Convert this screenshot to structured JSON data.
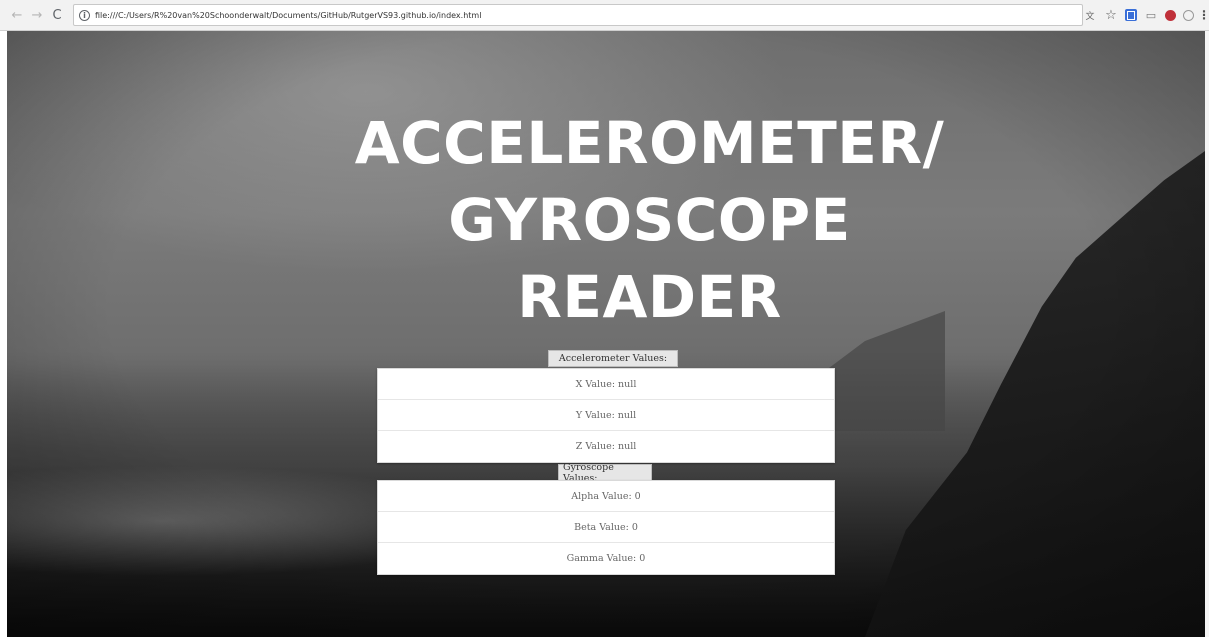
{
  "browser": {
    "url": "file:///C:/Users/R%20van%20Schoonderwalt/Documents/GitHub/RutgerVS93.github.io/index.html",
    "back_icon": "←",
    "forward_icon": "→",
    "reload_icon": "C",
    "info_icon": "i",
    "star_icon": "☆",
    "menu_icon": "⋮"
  },
  "page": {
    "title_lines": [
      "ACCELEROMETER/",
      "GYROSCOPE",
      "READER"
    ],
    "accelerometer": {
      "label": "Accelerometer Values:",
      "rows": [
        "X Value: null",
        "Y Value: null",
        "Z Value: null"
      ]
    },
    "gyroscope": {
      "label": "Gyroscope Values:",
      "rows": [
        "Alpha Value: 0",
        "Beta Value: 0",
        "Gamma Value: 0"
      ]
    }
  }
}
